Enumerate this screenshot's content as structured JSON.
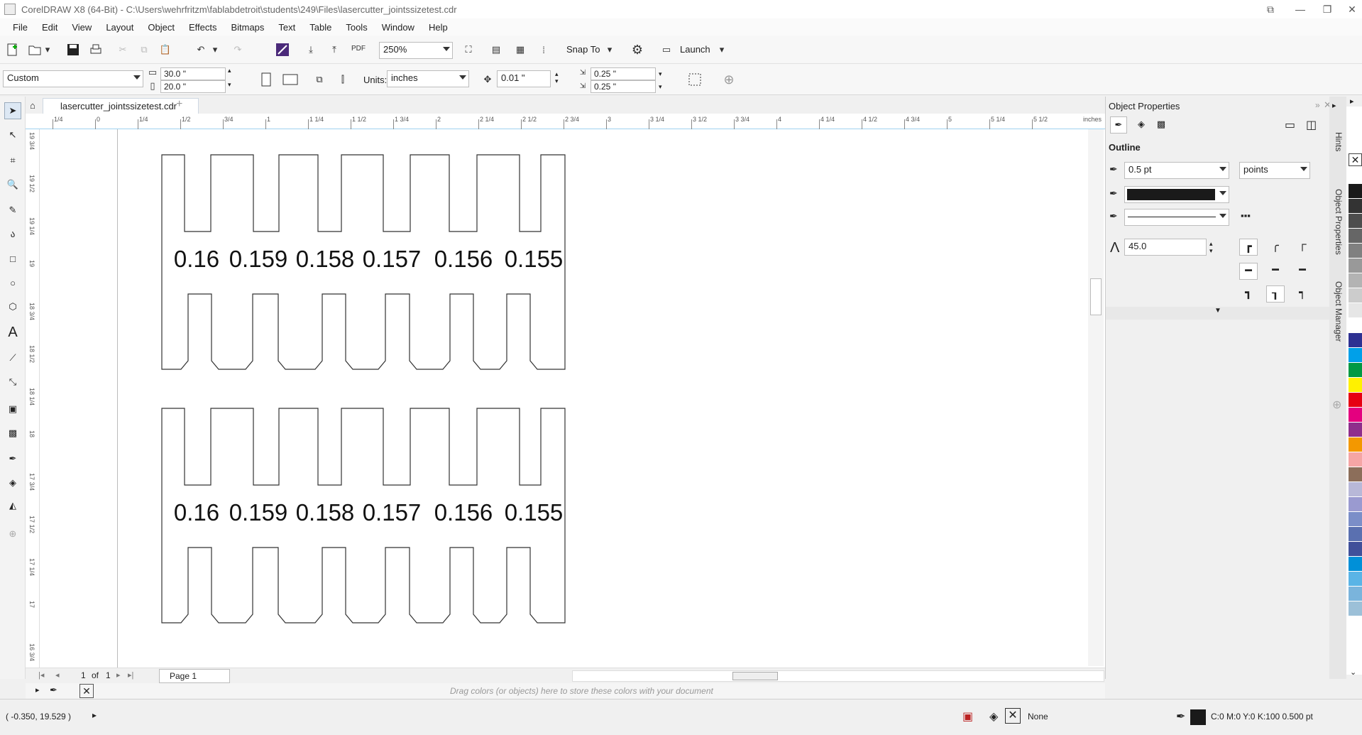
{
  "app": {
    "title": "CorelDRAW X8 (64-Bit) - C:\\Users\\wehrfritzm\\fablabdetroit\\students\\249\\Files\\lasercutter_jointssizetest.cdr"
  },
  "menu": [
    "File",
    "Edit",
    "View",
    "Layout",
    "Object",
    "Effects",
    "Bitmaps",
    "Text",
    "Table",
    "Tools",
    "Window",
    "Help"
  ],
  "toolbar": {
    "zoom": "250%",
    "snap_label": "Snap To",
    "launch_label": "Launch",
    "pdf_label": "PDF"
  },
  "propbar": {
    "page_size": "Custom",
    "width": "30.0 \"",
    "height": "20.0 \"",
    "units_label": "Units:",
    "units": "inches",
    "nudge": "0.01 \"",
    "dup_x": "0.25 \"",
    "dup_y": "0.25 \""
  },
  "doc": {
    "tab": "lasercutter_jointssizetest.cdr"
  },
  "ruler": {
    "h_labels": [
      "1/4",
      "0",
      "1/4",
      "1/2",
      "3/4",
      "1",
      "1 1/4",
      "1 1/2",
      "1 3/4",
      "2",
      "2 1/4",
      "2 1/2",
      "2 3/4",
      "3",
      "3 1/4",
      "3 1/2",
      "3 3/4",
      "4",
      "4 1/4",
      "4 1/2",
      "4 3/4",
      "5",
      "5 1/4",
      "5 1/2"
    ],
    "h_unit": "inches",
    "v_labels": [
      "19 3/4",
      "19 1/2",
      "19 1/4",
      "19",
      "18 3/4",
      "18 1/2",
      "18 1/4",
      "18",
      "17 3/4",
      "17 1/2",
      "17 1/4",
      "17",
      "16 3/4"
    ]
  },
  "drawing": {
    "labels_row1": [
      "0.16",
      "0.159",
      "0.158",
      "0.157",
      "0.156",
      "0.155"
    ],
    "labels_row2": [
      "0.16",
      "0.159",
      "0.158",
      "0.157",
      "0.156",
      "0.155"
    ]
  },
  "pager": {
    "current": "1",
    "of": "of",
    "total": "1",
    "page_tab": "Page 1"
  },
  "colordock": {
    "hint": "Drag colors (or objects) here to store these colors with your document"
  },
  "panel": {
    "title": "Object Properties",
    "outline_label": "Outline",
    "width": "0.5 pt",
    "units": "points",
    "miter": "45.0"
  },
  "side_tabs": [
    "Hints",
    "Object Properties",
    "Object Manager"
  ],
  "status": {
    "coords": "( -0.350, 19.529 )",
    "fill": "None",
    "outline": "C:0 M:0 Y:0 K:100  0.500 pt"
  },
  "palette": [
    "#ffffff",
    "#1a1a1a",
    "#333333",
    "#4d4d4d",
    "#666666",
    "#808080",
    "#999999",
    "#b3b3b3",
    "#cccccc",
    "#e6e6e6",
    "#ffffff",
    "#2e3192",
    "#00a0e9",
    "#009944",
    "#fff100",
    "#e60012",
    "#e4007f",
    "#8f2e8c",
    "#f39800",
    "#f5a5a5",
    "#8c6e5a",
    "#b8b8d8",
    "#9a9ad0",
    "#7b8ec8",
    "#5a70b0",
    "#40509a",
    "#0090d8",
    "#5ab4e6",
    "#7ab4dc",
    "#9cc0d8"
  ]
}
